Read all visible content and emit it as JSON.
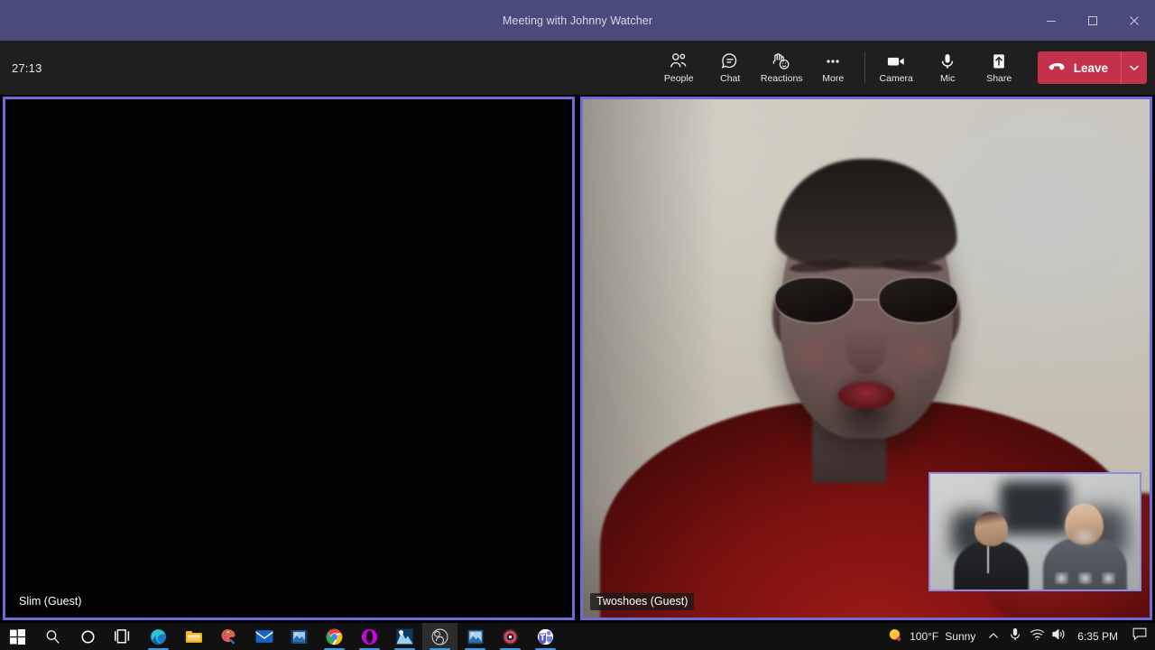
{
  "window": {
    "title": "Meeting with Johnny Watcher",
    "titlebar_color": "#4b4a7e",
    "controls": [
      {
        "name": "minimize",
        "glyph": "minimize-icon"
      },
      {
        "name": "maximize",
        "glyph": "maximize-icon"
      },
      {
        "name": "close",
        "glyph": "close-icon"
      }
    ]
  },
  "toolbar": {
    "timer": "27:13",
    "background": "#1f1f1f",
    "items": [
      {
        "label": "People",
        "icon": "people-icon"
      },
      {
        "label": "Chat",
        "icon": "chat-icon"
      },
      {
        "label": "Reactions",
        "icon": "reactions-icon"
      },
      {
        "label": "More",
        "icon": "more-ellipsis-icon"
      },
      {
        "label": "Camera",
        "icon": "camera-icon"
      },
      {
        "label": "Mic",
        "icon": "microphone-icon"
      },
      {
        "label": "Share",
        "icon": "share-up-arrow-icon"
      }
    ],
    "leave": {
      "label": "Leave",
      "icon": "hangup-phone-icon",
      "caret": "chevron-down-icon",
      "color": "#c4314b"
    }
  },
  "stage": {
    "active_border_color": "#6f6ad6",
    "tiles": [
      {
        "name": "Slim (Guest)",
        "video_on": false,
        "state": "camera off"
      },
      {
        "name": "Twoshoes (Guest)",
        "video_on": true,
        "state": "camera on"
      }
    ],
    "pip": {
      "label": "self-preview",
      "border_color": "#8f8be0"
    }
  },
  "taskbar": {
    "background": "#111112",
    "apps": [
      {
        "name": "start-button",
        "icon": "windows-logo-icon",
        "active": false,
        "running": false
      },
      {
        "name": "search-button",
        "icon": "search-icon",
        "active": false,
        "running": false
      },
      {
        "name": "cortana-button",
        "icon": "cortana-circle-icon",
        "active": false,
        "running": false
      },
      {
        "name": "task-view-button",
        "icon": "task-view-icon",
        "active": false,
        "running": false
      },
      {
        "name": "edge-button",
        "icon": "edge-icon",
        "active": false,
        "running": false
      },
      {
        "name": "file-explorer-button",
        "icon": "folder-icon",
        "active": false,
        "running": true
      },
      {
        "name": "paint-button",
        "icon": "paint-palette-icon",
        "active": false,
        "running": false
      },
      {
        "name": "mail-button",
        "icon": "mail-envelope-icon",
        "active": false,
        "running": false
      },
      {
        "name": "photos-button",
        "icon": "photos-filmstrip-icon",
        "active": false,
        "running": false
      },
      {
        "name": "chrome-button",
        "icon": "chrome-icon",
        "active": false,
        "running": true
      },
      {
        "name": "opera-button",
        "icon": "opera-icon",
        "active": false,
        "running": true
      },
      {
        "name": "krita-button",
        "icon": "krita-icon",
        "active": false,
        "running": true
      },
      {
        "name": "obs-button",
        "icon": "obs-studio-icon",
        "active": true,
        "running": true
      },
      {
        "name": "photo-viewer-button",
        "icon": "picture-icon",
        "active": false,
        "running": true
      },
      {
        "name": "media-button",
        "icon": "media-disc-icon",
        "active": false,
        "running": true
      },
      {
        "name": "teams-button",
        "icon": "teams-icon",
        "active": false,
        "running": true
      }
    ],
    "tray": {
      "weather_temp": "100°F",
      "weather_desc": "Sunny",
      "weather_icon": "sun-icon",
      "overflow_icon": "chevron-up-icon",
      "mic_icon": "microphone-icon",
      "network_icon": "wifi-icon",
      "volume_icon": "speaker-icon",
      "clock": "6:35 PM",
      "action_center_icon": "action-center-icon"
    }
  }
}
